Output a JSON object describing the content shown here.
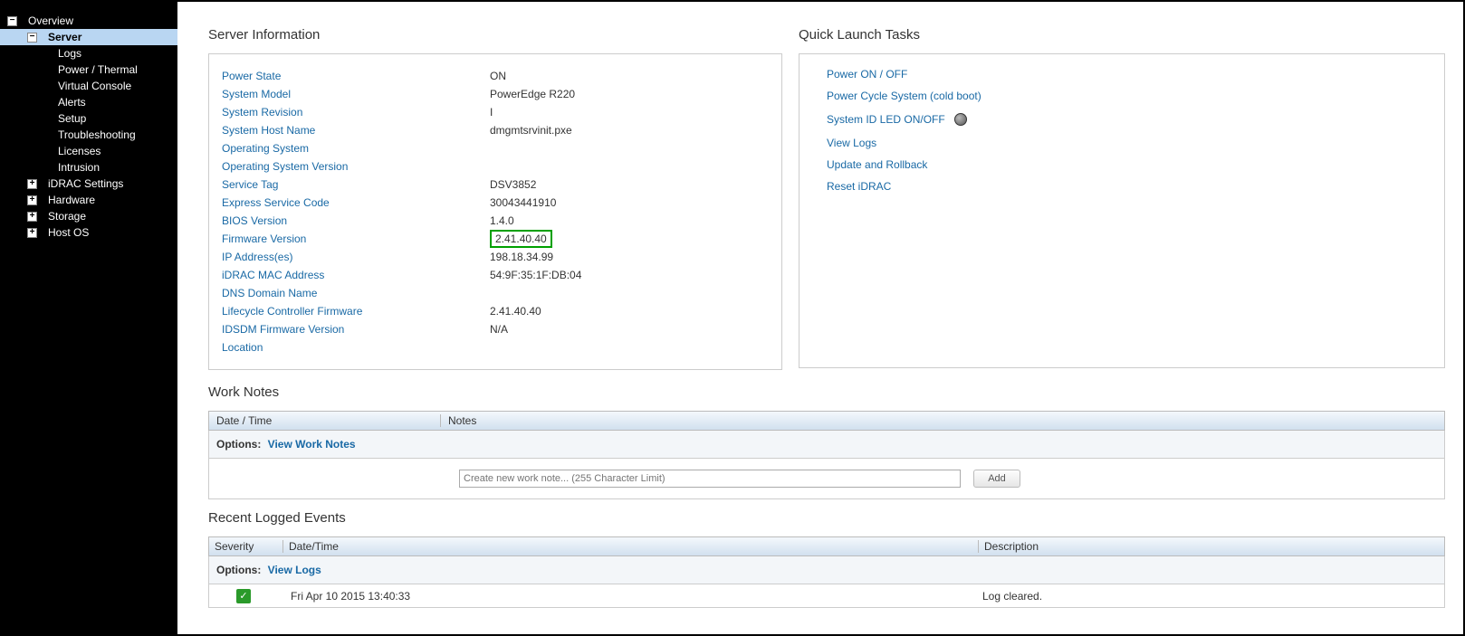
{
  "sidebar": {
    "overview": "Overview",
    "server": "Server",
    "logs": "Logs",
    "power_thermal": "Power / Thermal",
    "virtual_console": "Virtual Console",
    "alerts": "Alerts",
    "setup": "Setup",
    "troubleshooting": "Troubleshooting",
    "licenses": "Licenses",
    "intrusion": "Intrusion",
    "idrac_settings": "iDRAC Settings",
    "hardware": "Hardware",
    "storage": "Storage",
    "host_os": "Host OS"
  },
  "server_info": {
    "title": "Server Information",
    "rows": {
      "power_state_l": "Power State",
      "power_state_v": "ON",
      "system_model_l": "System Model",
      "system_model_v": "PowerEdge R220",
      "system_revision_l": "System Revision",
      "system_revision_v": "I",
      "host_name_l": "System Host Name",
      "host_name_v": "dmgmtsrvinit.pxe",
      "os_l": "Operating System",
      "os_v": "",
      "os_ver_l": "Operating System Version",
      "os_ver_v": "",
      "service_tag_l": "Service Tag",
      "service_tag_v": "DSV3852",
      "express_code_l": "Express Service Code",
      "express_code_v": "30043441910",
      "bios_l": "BIOS Version",
      "bios_v": "1.4.0",
      "firmware_l": "Firmware Version",
      "firmware_v": "2.41.40.40",
      "ip_l": "IP Address(es)",
      "ip_v": "198.18.34.99",
      "mac_l": "iDRAC MAC Address",
      "mac_v": "54:9F:35:1F:DB:04",
      "dns_l": "DNS Domain Name",
      "dns_v": "",
      "lifecycle_l": "Lifecycle Controller Firmware",
      "lifecycle_v": "2.41.40.40",
      "idsdm_l": "IDSDM Firmware Version",
      "idsdm_v": "N/A",
      "location_l": "Location",
      "location_v": ""
    }
  },
  "quick_launch": {
    "title": "Quick Launch Tasks",
    "power_onoff": "Power ON / OFF",
    "power_cycle": "Power Cycle System (cold boot)",
    "system_id_led": "System ID LED ON/OFF",
    "view_logs": "View Logs",
    "update_rollback": "Update and Rollback",
    "reset_idrac": "Reset iDRAC"
  },
  "work_notes": {
    "title": "Work Notes",
    "col_datetime": "Date / Time",
    "col_notes": "Notes",
    "options_label": "Options:",
    "view_link": "View Work Notes",
    "placeholder": "Create new work note... (255 Character Limit)",
    "add_btn": "Add"
  },
  "events": {
    "title": "Recent Logged Events",
    "col_severity": "Severity",
    "col_datetime": "Date/Time",
    "col_description": "Description",
    "options_label": "Options:",
    "view_link": "View Logs",
    "row0_dt": "Fri Apr 10 2015 13:40:33",
    "row0_desc": "Log cleared."
  }
}
